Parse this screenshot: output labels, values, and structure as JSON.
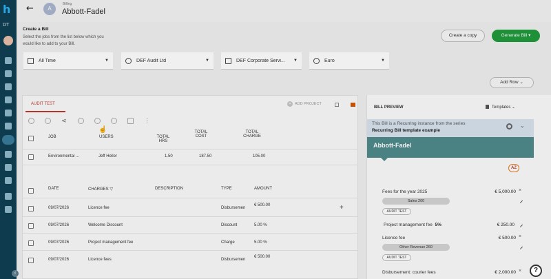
{
  "rail": {
    "org_label": "DT",
    "logo_letter": "h"
  },
  "header": {
    "subtitle": "Billing",
    "title": "Abbott-Fadel",
    "avatar_letter": "A"
  },
  "create": {
    "title": "Create a Bill",
    "description": "Select the jobs from the list below which you would like to add to your Bill."
  },
  "actions": {
    "copy_label": "Create a copy",
    "generate_label": "Generate Bill"
  },
  "filters": [
    {
      "label": "All Time",
      "icon": "calendar-icon"
    },
    {
      "label": "DEF Audit Ltd",
      "icon": "people-icon"
    },
    {
      "label": "DEF Corporate Servi...",
      "icon": "document-icon"
    },
    {
      "label": "Euro",
      "icon": "currency-icon"
    }
  ],
  "add_row_label": "Add Row",
  "left": {
    "tab": "AUDIT TEST",
    "add_project": "ADD PROJECT",
    "jobs_headers": {
      "job": "JOB",
      "users": "USERS",
      "total_hrs": "TOTAL HRS",
      "total_cost": "TOTAL COST",
      "total_charge": "TOTAL CHARGE"
    },
    "jobs": [
      {
        "job": "Environmental ...",
        "users": "Jeff Heller",
        "hrs": "1.50",
        "cost": "187.50",
        "charge": "105.00"
      }
    ],
    "charges_headers": {
      "date": "DATE",
      "charges": "CHARGES",
      "description": "DESCRIPTION",
      "type": "TYPE",
      "amount": "AMOUNT"
    },
    "charges": [
      {
        "date": "09/07/2026",
        "charge": "Licence fee",
        "type": "Disbursemen",
        "amount": "€ 500.00"
      },
      {
        "date": "09/07/2026",
        "charge": "Welcome Discount",
        "type": "Discount",
        "amount": "5.00 %"
      },
      {
        "date": "09/07/2026",
        "charge": "Project management fee",
        "type": "Charge",
        "amount": "5.00 %"
      },
      {
        "date": "09/07/2026",
        "charge": "Licence fees",
        "type": "Disbursemen",
        "amount": "€ 500.00"
      }
    ]
  },
  "preview": {
    "title": "BILL PREVIEW",
    "templates_label": "Templates",
    "recurring_line1": "This Bill is a Recurring instance from the series",
    "recurring_line2": "Recurring Bill template example",
    "client_name": "Abbott-Fadel",
    "sort_label": "AZ",
    "items": [
      {
        "label": "Fees for the year 2025",
        "amount": "€ 5,000.00",
        "pill": "Sales  200",
        "tag": "AUDIT TEST"
      },
      {
        "label": "Project management fee",
        "pct": "5%",
        "amount": "€ 250.00"
      },
      {
        "label": "Licence fee",
        "amount": "€ 500.00",
        "pill": "Other Revenue  260",
        "tag": "AUDIT TEST"
      },
      {
        "label": "Disbursement: courier fees",
        "amount": "€ 2,000.00"
      }
    ]
  },
  "help_label": "?"
}
